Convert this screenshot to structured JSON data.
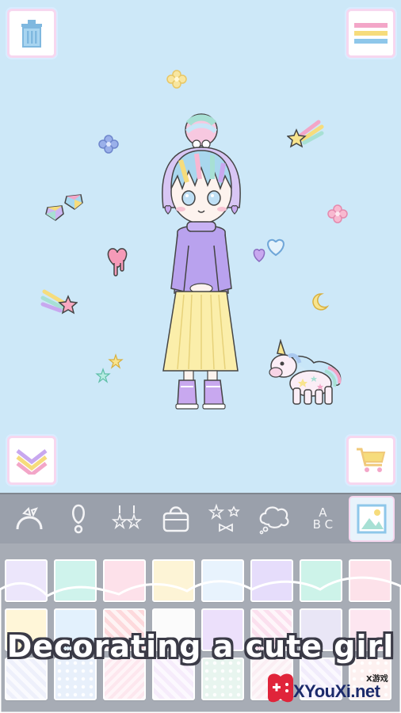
{
  "scene": {
    "background_color": "#cde8f8",
    "character": "pastel-doll-girl",
    "stickers": [
      "flower-icon",
      "flower-icon",
      "flower-icon",
      "shooting-star-icon",
      "shooting-star-icon",
      "gem-icon",
      "gem-icon",
      "heart-icon",
      "heart-icon",
      "dripping-heart-icon",
      "star-icon",
      "star-icon",
      "moon-icon",
      "unicorn-icon"
    ]
  },
  "buttons": {
    "trash_icon": "trash-icon",
    "menu_icon": "menu-icon",
    "collapse_icon": "double-chevron-down-icon",
    "cart_icon": "shopping-cart-icon"
  },
  "toolbar": {
    "categories": [
      {
        "id": "headband",
        "icon": "headband-icon"
      },
      {
        "id": "earring",
        "icon": "earring-icon"
      },
      {
        "id": "dangle-earrings",
        "icon": "dangle-earrings-icon"
      },
      {
        "id": "bag",
        "icon": "bag-icon"
      },
      {
        "id": "sparkle-bows",
        "icon": "sparkle-bow-icon"
      },
      {
        "id": "speech-bubble",
        "icon": "speech-bubble-icon"
      },
      {
        "id": "text",
        "icon": "abc-text-icon",
        "label": "A\nB C"
      },
      {
        "id": "background",
        "icon": "background-picture-icon",
        "active": true
      }
    ]
  },
  "panel": {
    "swatch_colors": [
      "#ece6fb",
      "#cff3ec",
      "#fde1ea",
      "#fdf4d6",
      "#e8f3fd",
      "#e6ddfb",
      "#cdf3e9",
      "#fde2ea",
      "#fff6d8",
      "#e3f1fd",
      "#fdd9dc",
      "#fbfbfb",
      "#ece0fb",
      "#fbe0ee",
      "#e9e6f6",
      "#fde6f0",
      "#eef0fb",
      "#e8f0fb",
      "#fde7ee",
      "#f6ecfb",
      "#e8f5ef",
      "#fbeef3",
      "#f1ecfb",
      "#fdf1f0"
    ],
    "accent_pink": "#f7d7ef"
  },
  "caption": "Decorating a cute girl",
  "watermark": {
    "site": "XYouXi.net",
    "cn": "X游戏"
  }
}
